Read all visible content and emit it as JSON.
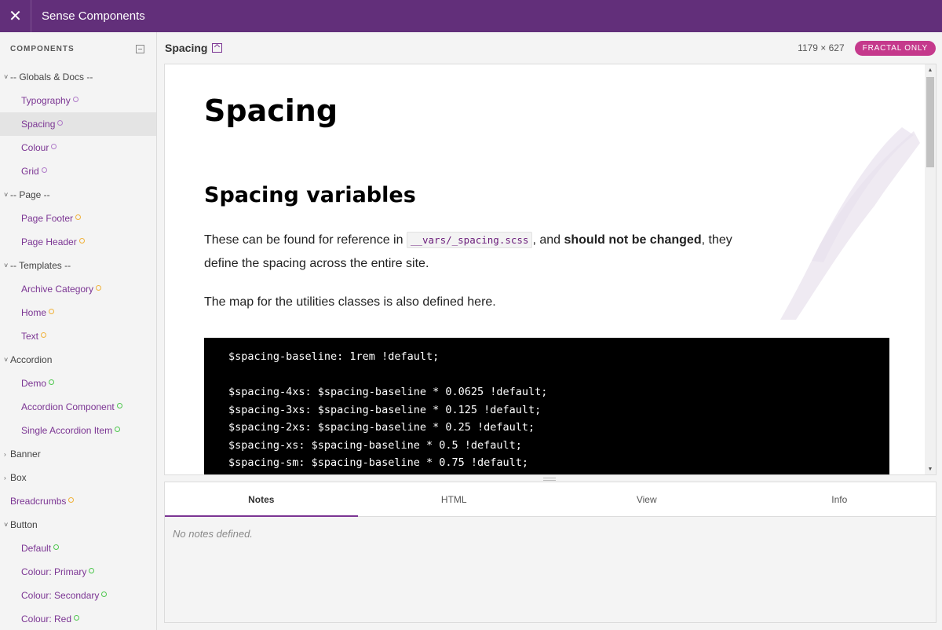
{
  "header": {
    "close_icon": "✕",
    "title": "Sense Components"
  },
  "sidebar": {
    "title": "COMPONENTS",
    "items": [
      {
        "label": "-- Globals & Docs --",
        "type": "group",
        "expanded": true
      },
      {
        "label": "Typography",
        "type": "leaf",
        "status": "purple"
      },
      {
        "label": "Spacing",
        "type": "leaf",
        "status": "purple",
        "active": true
      },
      {
        "label": "Colour",
        "type": "leaf",
        "status": "purple"
      },
      {
        "label": "Grid",
        "type": "leaf",
        "status": "purple"
      },
      {
        "label": "-- Page --",
        "type": "group",
        "expanded": true
      },
      {
        "label": "Page Footer",
        "type": "leaf",
        "status": "orange"
      },
      {
        "label": "Page Header",
        "type": "leaf",
        "status": "orange"
      },
      {
        "label": "-- Templates --",
        "type": "group",
        "expanded": true
      },
      {
        "label": "Archive Category",
        "type": "leaf",
        "status": "orange"
      },
      {
        "label": "Home",
        "type": "leaf",
        "status": "orange"
      },
      {
        "label": "Text",
        "type": "leaf",
        "status": "orange"
      },
      {
        "label": "Accordion",
        "type": "group",
        "expanded": true
      },
      {
        "label": "Demo",
        "type": "leaf",
        "status": "green"
      },
      {
        "label": "Accordion Component",
        "type": "leaf",
        "status": "green"
      },
      {
        "label": "Single Accordion Item",
        "type": "leaf",
        "status": "green"
      },
      {
        "label": "Banner",
        "type": "group",
        "expanded": false
      },
      {
        "label": "Box",
        "type": "group",
        "expanded": false
      },
      {
        "label": "Breadcrumbs",
        "type": "top-leaf",
        "status": "orange"
      },
      {
        "label": "Button",
        "type": "group",
        "expanded": true
      },
      {
        "label": "Default",
        "type": "leaf",
        "status": "green"
      },
      {
        "label": "Colour: Primary",
        "type": "leaf",
        "status": "green"
      },
      {
        "label": "Colour: Secondary",
        "type": "leaf",
        "status": "green"
      },
      {
        "label": "Colour: Red",
        "type": "leaf",
        "status": "green"
      }
    ]
  },
  "preview": {
    "title": "Spacing",
    "dims": "1179 × 627",
    "badge": "FRACTAL ONLY"
  },
  "doc": {
    "h1": "Spacing",
    "h2": "Spacing variables",
    "intro_pre": "These can be found for reference in ",
    "intro_code": "__vars/_spacing.scss",
    "intro_mid": ", and ",
    "intro_bold": "should not be changed",
    "intro_post": ", they define the spacing across the entire site.",
    "map_text": "The map for the utilities classes is also defined here.",
    "code_lines": [
      "$spacing-baseline: 1rem !default;",
      "",
      "$spacing-4xs: $spacing-baseline * 0.0625 !default;",
      "$spacing-3xs: $spacing-baseline * 0.125 !default;",
      "$spacing-2xs: $spacing-baseline * 0.25 !default;",
      "$spacing-xs: $spacing-baseline * 0.5 !default;",
      "$spacing-sm: $spacing-baseline * 0.75 !default;"
    ]
  },
  "tabs": [
    {
      "label": "Notes",
      "active": true
    },
    {
      "label": "HTML"
    },
    {
      "label": "View"
    },
    {
      "label": "Info"
    }
  ],
  "notes": {
    "empty_text": "No notes defined."
  },
  "colors": {
    "brand": "#622f7a",
    "accent": "#7b3593",
    "badge": "#c5398c"
  }
}
